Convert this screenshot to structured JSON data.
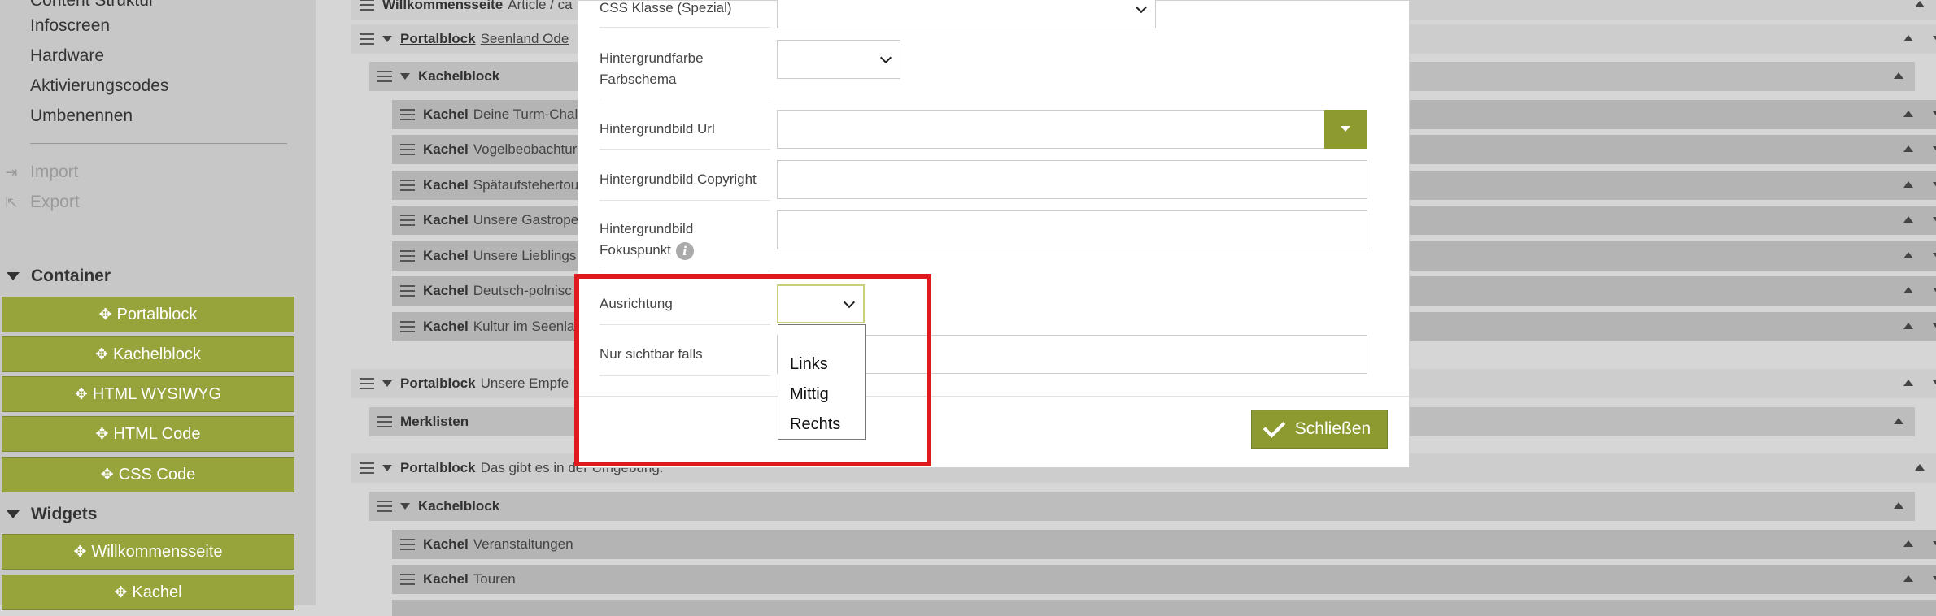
{
  "sidebar": {
    "nav": [
      "Content Struktur",
      "Infoscreen",
      "Hardware",
      "Aktivierungscodes",
      "Umbenennen"
    ],
    "import_label": "Import",
    "export_label": "Export",
    "container_title": "Container",
    "container_items": [
      "Portalblock",
      "Kachelblock",
      "HTML WYSIWYG",
      "HTML Code",
      "CSS Code"
    ],
    "widgets_title": "Widgets",
    "widget_items": [
      "Willkommensseite",
      "Kachel"
    ]
  },
  "tree": {
    "rows": [
      {
        "type": "Willkommensseite",
        "text": "Article / ca"
      },
      {
        "type": "Portalblock",
        "text": "Seenland Ode"
      },
      {
        "type": "Kachelblock",
        "text": ""
      },
      {
        "type": "Kachel",
        "text": "Deine Turm-Chal"
      },
      {
        "type": "Kachel",
        "text": "Vogelbeobachtur"
      },
      {
        "type": "Kachel",
        "text": "Spätaufstehertou"
      },
      {
        "type": "Kachel",
        "text": "Unsere Gastrope"
      },
      {
        "type": "Kachel",
        "text": "Unsere Lieblings"
      },
      {
        "type": "Kachel",
        "text": "Deutsch-polnisc"
      },
      {
        "type": "Kachel",
        "text": "Kultur im Seenla"
      },
      {
        "type": "Portalblock",
        "text": "Unsere Empfe"
      },
      {
        "type": "Merklisten",
        "text": ""
      },
      {
        "type": "Portalblock",
        "text": "Das gibt es in der Umgebung:"
      },
      {
        "type": "Kachelblock",
        "text": ""
      },
      {
        "type": "Kachel",
        "text": "Veranstaltungen"
      },
      {
        "type": "Kachel",
        "text": "Touren"
      }
    ]
  },
  "modal": {
    "css_klasse_label": "CSS Klasse (Spezial)",
    "hintergrundfarbe_label": "Hintergrundfarbe Farbschema",
    "hintergrundbild_url_label": "Hintergrundbild Url",
    "hintergrundbild_copyright_label": "Hintergrundbild Copyright",
    "hintergrundbild_fokus_label_1": "Hintergrundbild",
    "hintergrundbild_fokus_label_2": "Fokuspunkt",
    "ausrichtung_label": "Ausrichtung",
    "nur_sichtbar_label": "Nur sichtbar falls",
    "ausrichtung_options": [
      "",
      "Links",
      "Mittig",
      "Rechts"
    ],
    "close_label": "Schließen"
  },
  "colors": {
    "accent": "#97a33b",
    "accent_dark": "#8d9a2f",
    "highlight": "#e0191e"
  }
}
